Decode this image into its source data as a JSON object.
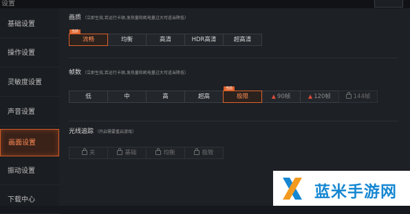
{
  "window": {
    "title": "设置"
  },
  "sidebar": {
    "items": [
      {
        "label": "基础设置",
        "active": false
      },
      {
        "label": "操作设置",
        "active": false
      },
      {
        "label": "灵敏度设置",
        "active": false
      },
      {
        "label": "声音设置",
        "active": false
      },
      {
        "label": "画面设置",
        "active": true
      },
      {
        "label": "振动设置",
        "active": false
      },
      {
        "label": "下载中心",
        "active": false
      }
    ]
  },
  "quality": {
    "title": "画质",
    "note": "（立即生效,若运行卡顿,发热量和耗电量过大可适当降低）",
    "tag": "当前",
    "options": [
      {
        "label": "流畅",
        "state": "selected"
      },
      {
        "label": "均衡",
        "state": "normal"
      },
      {
        "label": "高清",
        "state": "normal"
      },
      {
        "label": "HDR高清",
        "state": "normal"
      },
      {
        "label": "超高清",
        "state": "normal"
      }
    ]
  },
  "framerate": {
    "title": "帧数",
    "note": "（立即生效,若运行卡顿,发热量和耗电量过大可适当降低）",
    "tag": "当前",
    "options": [
      {
        "label": "低",
        "state": "normal"
      },
      {
        "label": "中",
        "state": "normal"
      },
      {
        "label": "高",
        "state": "normal"
      },
      {
        "label": "超高",
        "state": "normal"
      },
      {
        "label": "极限",
        "state": "selected"
      },
      {
        "label": "90帧",
        "state": "warn"
      },
      {
        "label": "120帧",
        "state": "warn"
      },
      {
        "label": "144帧",
        "state": "locked"
      }
    ]
  },
  "raytracing": {
    "title": "光线追踪",
    "note": "（开启需要重启游戏）",
    "options": [
      {
        "label": "关",
        "state": "locked"
      },
      {
        "label": "基础",
        "state": "locked"
      },
      {
        "label": "均衡",
        "state": "locked"
      },
      {
        "label": "极致",
        "state": "locked"
      }
    ]
  },
  "watermark": {
    "text": "蓝米手游网"
  },
  "colors": {
    "accent": "#e0622a",
    "warning": "#d84a3a",
    "watermark": "#1687d2"
  }
}
